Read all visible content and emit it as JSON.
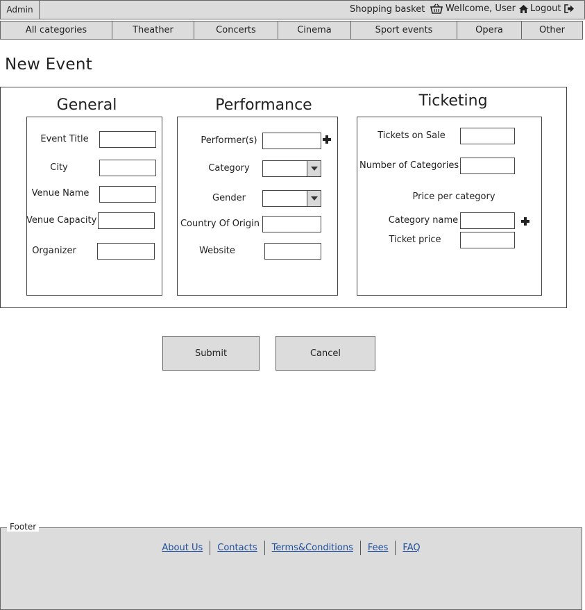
{
  "topbar": {
    "admin_label": "Admin",
    "basket_label": "Shopping basket",
    "welcome_label": "Wellcome, User",
    "logout_label": "Logout"
  },
  "nav": {
    "tabs": [
      {
        "label": "All categories"
      },
      {
        "label": "Theather"
      },
      {
        "label": "Concerts"
      },
      {
        "label": "Cinema"
      },
      {
        "label": "Sport events"
      },
      {
        "label": "Opera"
      },
      {
        "label": "Other"
      }
    ]
  },
  "page": {
    "title": "New Event"
  },
  "general": {
    "title": "General",
    "event_title_label": "Event Title",
    "event_title_value": "",
    "city_label": "City",
    "city_value": "",
    "venue_name_label": "Venue Name",
    "venue_name_value": "",
    "venue_capacity_label": "Venue Capacity",
    "venue_capacity_value": "",
    "organizer_label": "Organizer",
    "organizer_value": ""
  },
  "performance": {
    "title": "Performance",
    "performers_label": "Performer(s)",
    "performers_value": "",
    "category_label": "Category",
    "category_value": "",
    "gender_label": "Gender",
    "gender_value": "",
    "country_label": "Country Of Origin",
    "country_value": "",
    "website_label": "Website",
    "website_value": ""
  },
  "ticketing": {
    "title": "Ticketing",
    "tickets_on_sale_label": "Tickets on Sale",
    "tickets_on_sale_value": "",
    "num_categories_label": "Number of Categories",
    "num_categories_value": "",
    "price_per_category_label": "Price per category",
    "category_name_label": "Category name",
    "category_name_value": "",
    "ticket_price_label": "Ticket price",
    "ticket_price_value": ""
  },
  "actions": {
    "submit_label": "Submit",
    "cancel_label": "Cancel"
  },
  "footer": {
    "legend": "Footer",
    "links": [
      {
        "label": "About Us"
      },
      {
        "label": "Contacts"
      },
      {
        "label": "Terms&Conditions"
      },
      {
        "label": "Fees"
      },
      {
        "label": "FAQ"
      }
    ]
  },
  "icons": {
    "basket": "basket-icon",
    "home": "home-icon",
    "logout": "logout-icon",
    "plus": "plus-icon",
    "dropdown": "chevron-down-icon"
  },
  "colors": {
    "bar_bg": "#dcdcdc",
    "link": "#1f4f9c",
    "border": "#444444"
  }
}
